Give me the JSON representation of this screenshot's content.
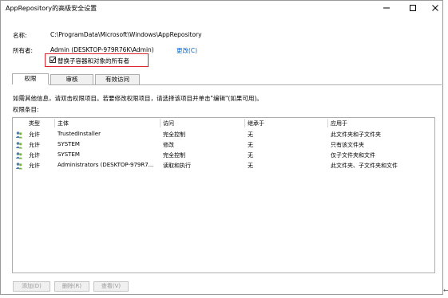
{
  "window": {
    "title": "AppRepository的高级安全设置",
    "controls": {
      "minimize": "—",
      "maximize": "☐",
      "close": "✕"
    }
  },
  "info": {
    "name_label": "名称:",
    "name_value": "C:\\ProgramData\\Microsoft\\Windows\\AppRepository",
    "owner_label": "所有者:",
    "owner_value": "Admin (DESKTOP-979R76K\\Admin)",
    "change_link": "更改(C)",
    "replace_owner_checkbox": {
      "label": "替换子容器和对象的所有者",
      "checked": true
    }
  },
  "tabs": [
    {
      "label": "权限",
      "active": true
    },
    {
      "label": "审核",
      "active": false
    },
    {
      "label": "有效访问",
      "active": false
    }
  ],
  "instructions": "如需其他信息，请双击权限项目。若要修改权限项目，请选择该项目并单击\"编辑\"(如果可用)。",
  "entries_label": "权限条目:",
  "table": {
    "columns": [
      "类型",
      "主体",
      "访问",
      "继承于",
      "应用于"
    ],
    "rows": [
      {
        "type": "允许",
        "principal": "TrustedInstaller",
        "access": "完全控制",
        "inherited": "无",
        "applies": "此文件夹和子文件夹"
      },
      {
        "type": "允许",
        "principal": "SYSTEM",
        "access": "修改",
        "inherited": "无",
        "applies": "只有该文件夹"
      },
      {
        "type": "允许",
        "principal": "SYSTEM",
        "access": "完全控制",
        "inherited": "无",
        "applies": "仅子文件夹和文件"
      },
      {
        "type": "允许",
        "principal": "Administrators (DESKTOP-979R7...",
        "access": "读取和执行",
        "inherited": "无",
        "applies": "此文件夹、子文件夹和文件"
      }
    ]
  },
  "buttons": {
    "add": "添加(D)",
    "remove": "删除(R)",
    "view": "查看(V)"
  },
  "colors": {
    "highlight": "#d9252c",
    "link": "#0066cc",
    "disabled_text": "#9a9a9a"
  }
}
